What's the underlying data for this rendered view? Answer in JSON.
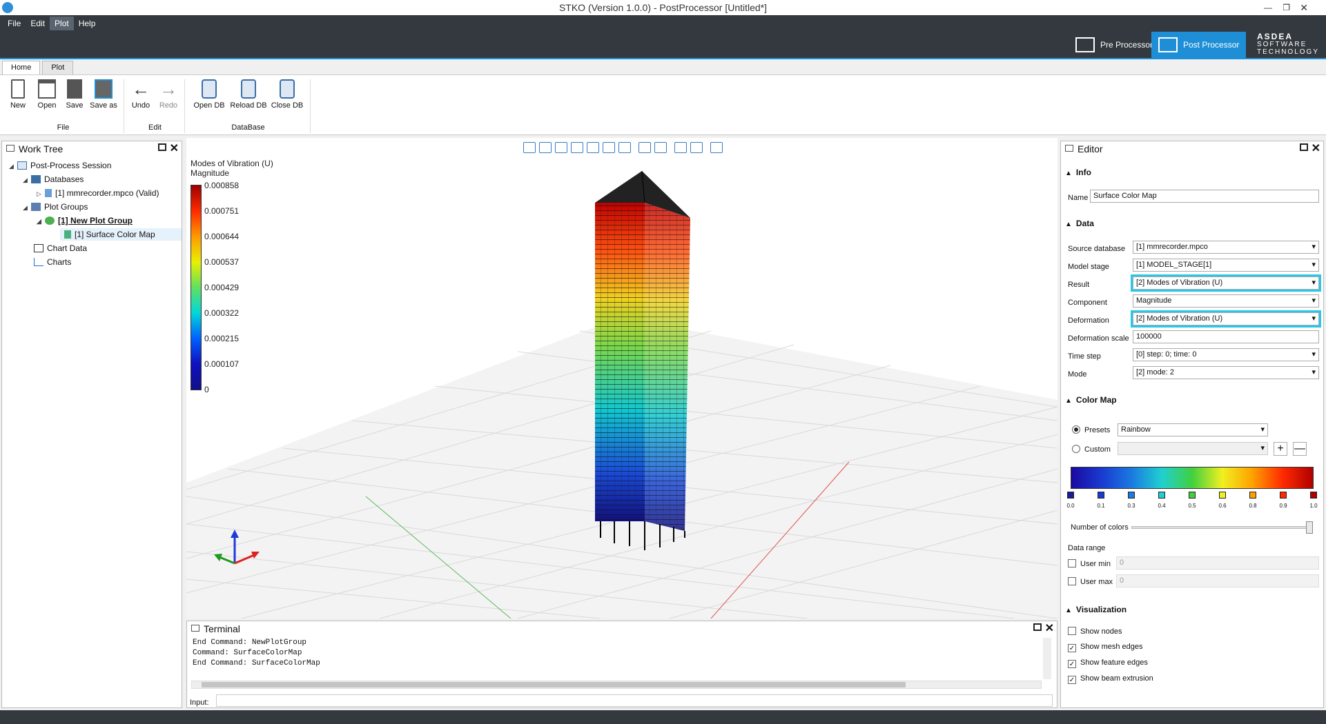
{
  "window": {
    "title": "STKO (Version 1.0.0) - PostProcessor [Untitled*]"
  },
  "menu": [
    "File",
    "Edit",
    "Plot",
    "Help"
  ],
  "modes": {
    "pre": "Pre Processor",
    "post": "Post Processor"
  },
  "brand": {
    "line1": "ASDEA",
    "line2": "SOFTWARE",
    "line3": "TECHNOLOGY"
  },
  "ribbon": {
    "tabs": [
      "Home",
      "Plot"
    ],
    "buttons": {
      "new": "New",
      "open": "Open",
      "save": "Save",
      "save_as": "Save as",
      "undo": "Undo",
      "redo": "Redo",
      "open_db": "Open DB",
      "reload_db": "Reload DB",
      "close_db": "Close DB"
    },
    "groups": {
      "file": "File",
      "edit": "Edit",
      "database": "DataBase"
    }
  },
  "work_tree": {
    "title": "Work Tree",
    "items": [
      "Post-Process Session",
      "Databases",
      "[1] mmrecorder.mpco (Valid)",
      "Plot Groups",
      "[1] New Plot Group",
      "[1] Surface Color Map",
      "Chart Data",
      "Charts"
    ]
  },
  "viewport": {
    "legend_title": "Modes of Vibration (U)",
    "legend_subtitle": "Magnitude",
    "ticks": [
      "0.000858",
      "0.000751",
      "0.000644",
      "0.000537",
      "0.000429",
      "0.000322",
      "0.000215",
      "0.000107",
      "0"
    ]
  },
  "terminal": {
    "title": "Terminal",
    "lines": [
      "End Command: NewPlotGroup",
      "Command: SurfaceColorMap",
      "End Command: SurfaceColorMap"
    ],
    "input_label": "Input:"
  },
  "editor": {
    "title": "Editor",
    "sections": {
      "info": "Info",
      "data": "Data",
      "color_map": "Color Map",
      "visualization": "Visualization"
    },
    "labels": {
      "name": "Name",
      "source_database": "Source database",
      "model_stage": "Model stage",
      "result": "Result",
      "component": "Component",
      "deformation": "Deformation",
      "deformation_scale": "Deformation scale",
      "time_step": "Time step",
      "mode": "Mode"
    },
    "values": {
      "name": "Surface Color Map",
      "source_database": "[1] mmrecorder.mpco",
      "model_stage": "[1] MODEL_STAGE[1]",
      "result": "[2] Modes of Vibration (U)",
      "component": "Magnitude",
      "deformation": "[2] Modes of Vibration (U)",
      "deformation_scale": "100000",
      "time_step": "[0] step: 0; time: 0",
      "mode": "[2] mode: 2"
    },
    "color_map": {
      "presets_label": "Presets",
      "presets_value": "Rainbow",
      "custom_label": "Custom",
      "stops": [
        "0.0",
        "0.1",
        "0.3",
        "0.4",
        "0.5",
        "0.6",
        "0.8",
        "0.9",
        "1.0"
      ],
      "stop_colors": [
        "#1a1a9a",
        "#1a3ad0",
        "#1a7ae0",
        "#20d0d0",
        "#40d040",
        "#f0f020",
        "#ffa000",
        "#ff2a00",
        "#b00000"
      ],
      "number_of_colors": "Number of colors",
      "data_range": "Data range",
      "user_min": "User min",
      "user_max": "User max",
      "user_min_value": "0",
      "user_max_value": "0"
    },
    "visualization": {
      "show_nodes": "Show nodes",
      "show_mesh_edges": "Show mesh edges",
      "show_feature_edges": "Show feature edges",
      "show_beam_extrusion": "Show beam extrusion"
    }
  }
}
